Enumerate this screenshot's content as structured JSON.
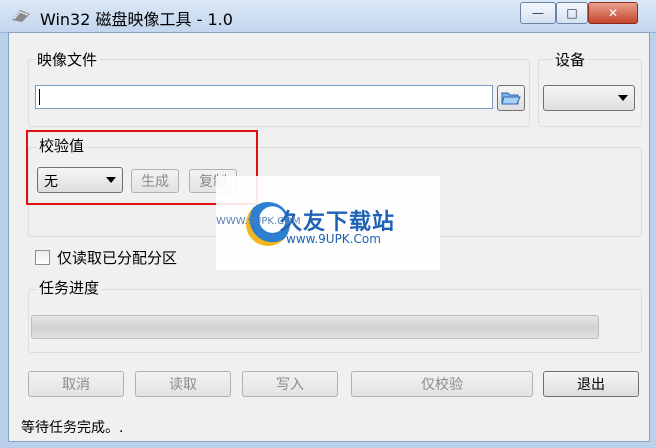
{
  "window": {
    "title": "Win32 磁盘映像工具 - 1.0",
    "buttons": {
      "minimize": "—",
      "maximize": "□",
      "close": "✕"
    }
  },
  "image_file": {
    "label": "映像文件",
    "path_value": ""
  },
  "device": {
    "label": "设备",
    "selected": ""
  },
  "checksum": {
    "label": "校验值",
    "selected": "无",
    "generate_label": "生成",
    "copy_label": "复制"
  },
  "read_only": {
    "label": "仅读取已分配分区",
    "checked": false
  },
  "progress": {
    "label": "任务进度",
    "value": 0
  },
  "actions": {
    "cancel": "取消",
    "read": "读取",
    "write": "写入",
    "verify": "仅校验",
    "exit": "退出"
  },
  "status": {
    "text": "等待任务完成。."
  },
  "watermark": {
    "main": "久友下载站",
    "url": "www.9UPK.Com",
    "small": "WWW.9UPK.COM"
  },
  "colors": {
    "accent": "#e01010",
    "watermark": "#1f62b4"
  },
  "icons": [
    "app-icon",
    "folder-open-icon",
    "dropdown-arrow-icon"
  ]
}
